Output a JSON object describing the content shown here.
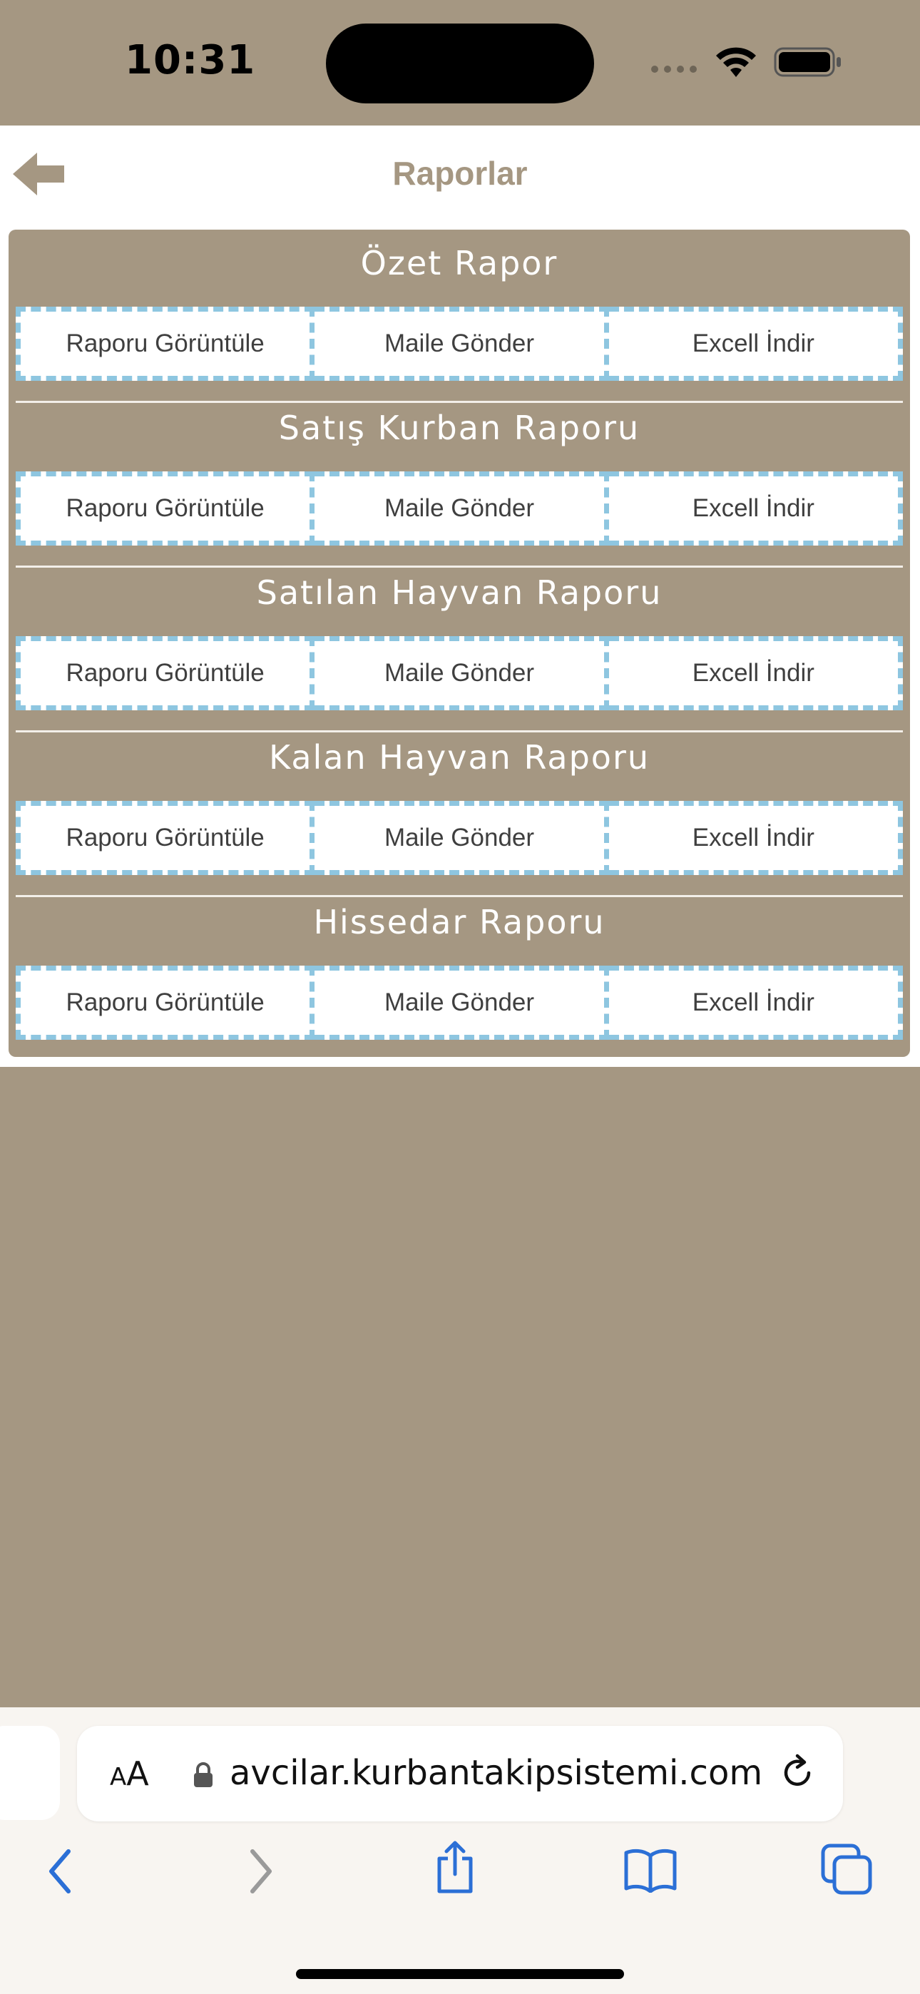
{
  "status_bar": {
    "time": "10:31"
  },
  "nav": {
    "title": "Raporlar",
    "back_icon": "back-arrow-icon"
  },
  "sections": [
    {
      "title": "Özet Rapor",
      "buttons": [
        "Raporu Görüntüle",
        "Maile Gönder",
        "Excell İndir"
      ]
    },
    {
      "title": "Satış Kurban Raporu",
      "buttons": [
        "Raporu Görüntüle",
        "Maile Gönder",
        "Excell İndir"
      ]
    },
    {
      "title": "Satılan Hayvan Raporu",
      "buttons": [
        "Raporu Görüntüle",
        "Maile Gönder",
        "Excell İndir"
      ]
    },
    {
      "title": "Kalan Hayvan Raporu",
      "buttons": [
        "Raporu Görüntüle",
        "Maile Gönder",
        "Excell İndir"
      ]
    },
    {
      "title": "Hissedar Raporu",
      "buttons": [
        "Raporu Görüntüle",
        "Maile Gönder",
        "Excell İndir"
      ]
    }
  ],
  "browser": {
    "text_size_label_small": "A",
    "text_size_label_large": "A",
    "url": "avcilar.kurbantakipsistemi.com"
  },
  "colors": {
    "background": "#a59782",
    "title_color": "#a59782",
    "button_border": "#8ec6e0",
    "browser_blue": "#2b6fd6"
  }
}
